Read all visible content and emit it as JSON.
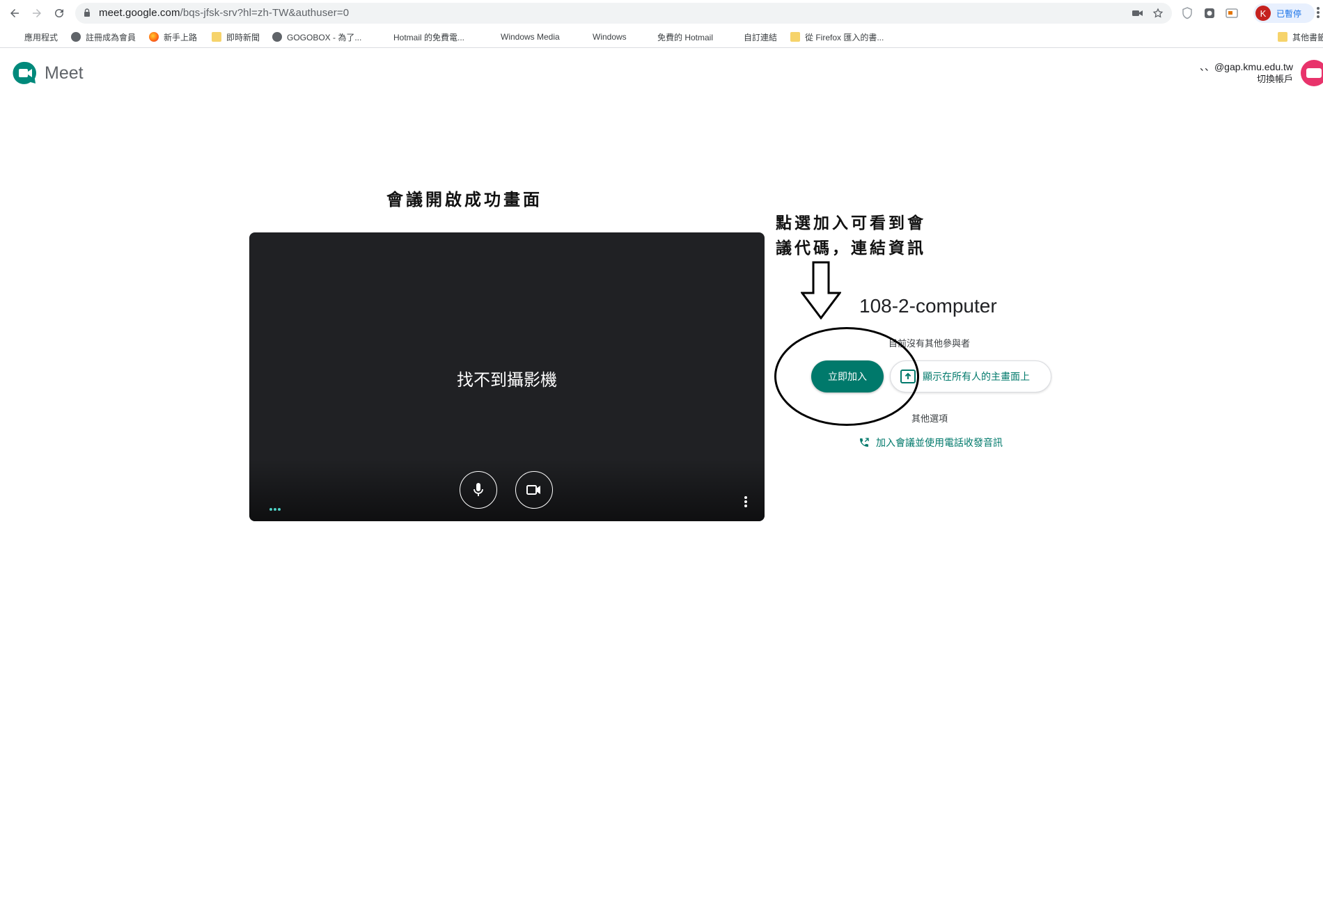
{
  "browser": {
    "url_host": "meet.google.com",
    "url_path": "/bqs-jfsk-srv?hl=zh-TW&authuser=0",
    "profile_initial": "K",
    "profile_label": "已暫停"
  },
  "bookmarks": [
    {
      "label": "應用程式",
      "icon": "apps-icon"
    },
    {
      "label": "註冊成為會員",
      "icon": "globe-icon"
    },
    {
      "label": "新手上路",
      "icon": "firefox-icon"
    },
    {
      "label": "即時新聞",
      "icon": "folder-icon"
    },
    {
      "label": "GOGOBOX - 為了...",
      "icon": "globe-icon"
    },
    {
      "label": "Hotmail 的免費電...",
      "icon": "microsoft-icon"
    },
    {
      "label": "Windows Media",
      "icon": "microsoft-icon"
    },
    {
      "label": "Windows",
      "icon": "microsoft-icon"
    },
    {
      "label": "免費的 Hotmail",
      "icon": "microsoft-icon"
    },
    {
      "label": "自訂連結",
      "icon": "microsoft-icon"
    },
    {
      "label": "從 Firefox 匯入的書...",
      "icon": "folder-icon"
    },
    {
      "label": "其他書籤",
      "icon": "folder-icon"
    }
  ],
  "meet": {
    "brand": "Meet",
    "account_email": "、、@gap.kmu.edu.tw",
    "switch_account": "切換帳戶"
  },
  "annotation": {
    "title": "會議開啟成功畫面",
    "note_line1": "點選加入可看到會",
    "note_line2": "議代碼，連結資訊"
  },
  "preview": {
    "no_camera": "找不到攝影機"
  },
  "join": {
    "meeting_name": "108-2-computer",
    "participants_status": "目前沒有其他參與者",
    "join_label": "立即加入",
    "present_label": "顯示在所有人的主畫面上",
    "other_options": "其他選項",
    "phone_audio": "加入會議並使用電話收發音訊"
  },
  "colors": {
    "accent": "#00796b",
    "preview_bg": "#202124"
  }
}
